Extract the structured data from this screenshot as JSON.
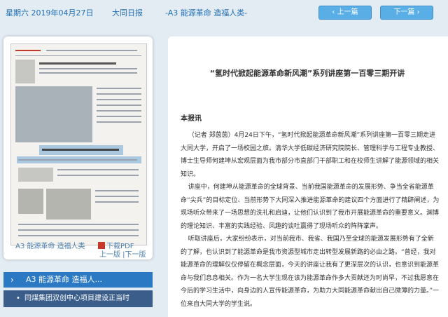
{
  "header": {
    "date": "星期六 2019年04月27日",
    "paper": "大同日报",
    "page": "-A3 能源革命 造福人类-",
    "prev_btn": "上一篇",
    "next_btn": "下一篇"
  },
  "page_panel": {
    "page_label": "A3 能源革命 造福人类",
    "pdf_label": "下载PDF",
    "nav_label": "上一版 |下一版"
  },
  "article_list": {
    "section": "A3  能源革命 造福人...",
    "items": [
      "同煤集团双创中心项目建设正当时"
    ]
  },
  "article": {
    "title": "“氢时代掀起能源革命新风潮”系列讲座第一百零三期开讲",
    "byline": "本报讯",
    "paragraphs": [
      "（记者 郑茵茵）4月24日下午，“氢时代掀起能源革命新风潮”系列讲座第一百零三期走进大同大学，开启了一场校园之旅。清华大学低碳经济研究院院长、管理科学与工程专业教授、博士生导师何建坤从宏观层面为我市部分市直部门干部职工和在校师生讲解了能源领域的相关知识。",
      "讲座中，何建坤从能源革命的全球背景、当前我国能源革命的发展形势、争当全省能源革命“尖兵”的目标定位、当前形势下大同深入推进能源革命的建议四个方面进行了精辟阐述，为现场听众带来了一场思想的洗礼和启迪，让他们认识到了我市开展能源革命的重要意义。渊博的理论知识、丰富的实践经验、风趣的谈吐赢得了现场听众的阵阵掌声。",
      "听取讲座后，大家纷纷表示，对当前我市、我省、我国乃至全球的能源发展形势有了全新的了解，也认识到了能源革命是我市资源型城市走出转型发展新路的必由之路。“曾经，我对能源革命的理解仅仅停留在概念层面，今天的讲座让我有了更深层次的认识，也意识到能源革命与我们息息相关。作为一名大学生现在该为能源革命作多大贡献还为时尚早，不过我愿意在今后的学习生活中，向身边的人宣传能源革命，为助力大同能源革命献出自己微薄的力量。”一位来自大同大学的学生说。"
    ]
  }
}
